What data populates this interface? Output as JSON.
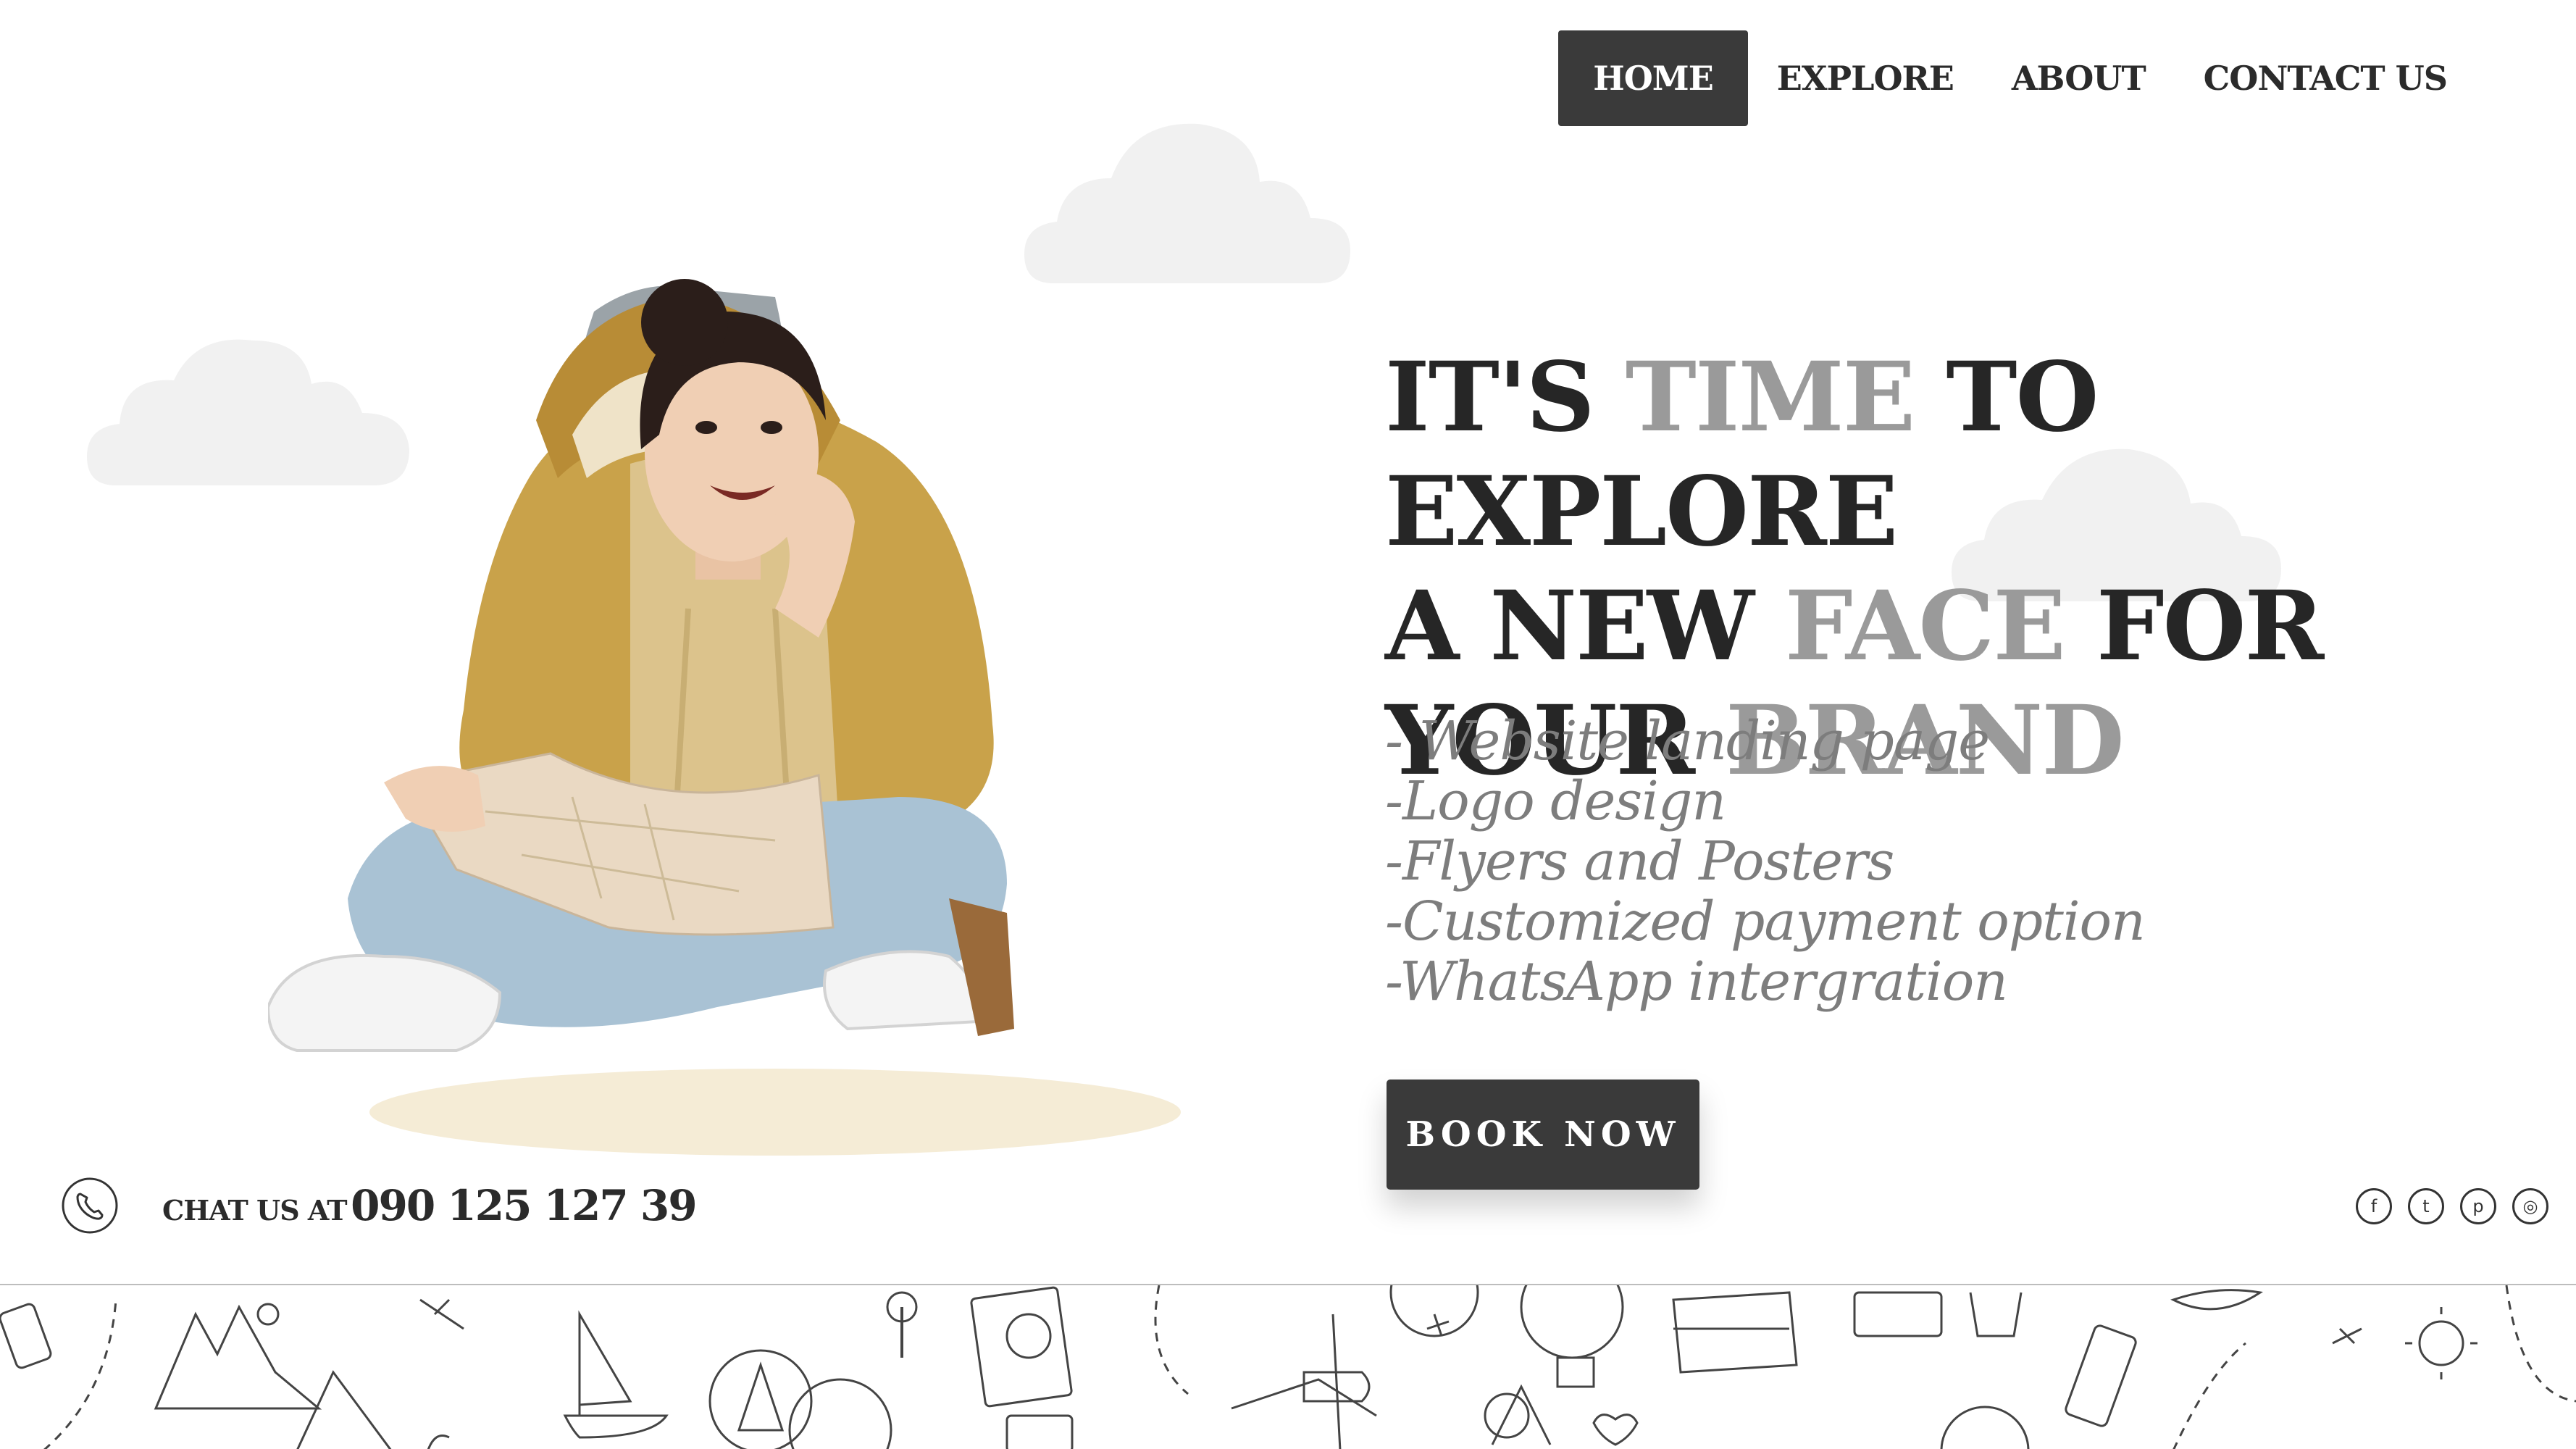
{
  "nav": {
    "items": [
      {
        "label": "HOME",
        "active": true
      },
      {
        "label": "EXPLORE",
        "active": false
      },
      {
        "label": "ABOUT",
        "active": false
      },
      {
        "label": "CONTACT US",
        "active": false
      }
    ]
  },
  "headline": {
    "line1": {
      "a": "IT'S ",
      "b": "TIME",
      "c": " TO EXPLORE"
    },
    "line2": {
      "a": "A NEW ",
      "b": "FACE",
      "c": " FOR"
    },
    "line3": {
      "a": "YOUR ",
      "b": "BRAND"
    }
  },
  "services": [
    "- Website landing page",
    "-Logo design",
    "-Flyers and Posters",
    "-Customized payment option",
    "-WhatsApp intergration"
  ],
  "cta": {
    "label": "BOOK NOW"
  },
  "contact": {
    "label": "CHAT US AT",
    "number": "090 125 127 39"
  },
  "social": [
    {
      "icon": "facebook-icon",
      "glyph": "f"
    },
    {
      "icon": "twitter-icon",
      "glyph": "t"
    },
    {
      "icon": "pinterest-icon",
      "glyph": "p"
    },
    {
      "icon": "instagram-icon",
      "glyph": "◎"
    }
  ],
  "colors": {
    "dark": "#3a3a3a",
    "text": "#262626",
    "muted": "#9a9a9a",
    "script": "#7d7d7d",
    "jacket": "#c9a24a",
    "jeans": "#a9c2d4"
  }
}
